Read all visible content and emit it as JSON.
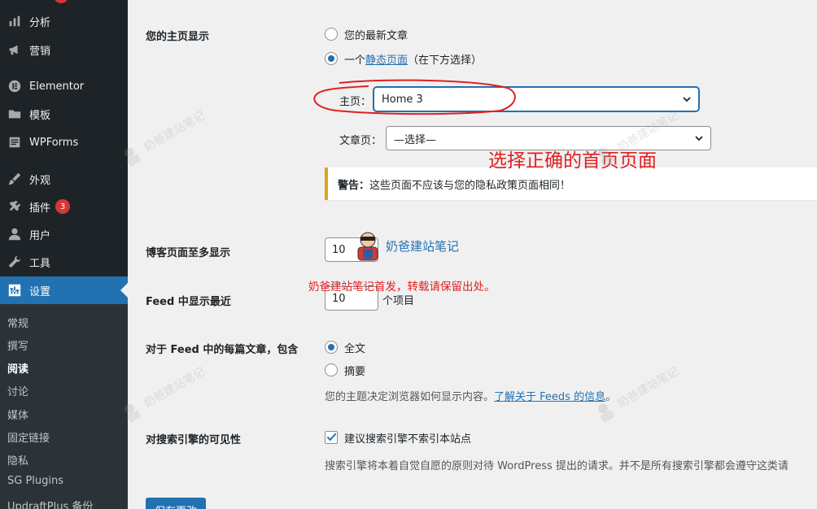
{
  "sidebar": {
    "menu": [
      {
        "label": "分析",
        "icon": "bar-chart-icon",
        "badge": ""
      },
      {
        "label": "营销",
        "icon": "megaphone-icon",
        "badge": ""
      },
      {
        "label": "Elementor",
        "icon": "elementor-icon",
        "badge": ""
      },
      {
        "label": "模板",
        "icon": "folder-icon",
        "badge": ""
      },
      {
        "label": "WPForms",
        "icon": "form-icon",
        "badge": ""
      },
      {
        "label": "外观",
        "icon": "brush-icon",
        "badge": ""
      },
      {
        "label": "插件",
        "icon": "plugin-icon",
        "badge": "3"
      },
      {
        "label": "用户",
        "icon": "user-icon",
        "badge": ""
      },
      {
        "label": "工具",
        "icon": "wrench-icon",
        "badge": ""
      },
      {
        "label": "设置",
        "icon": "settings-icon",
        "badge": ""
      }
    ],
    "submenu": [
      "常规",
      "撰写",
      "阅读",
      "讨论",
      "媒体",
      "固定链接",
      "隐私",
      "SG Plugins",
      "UpdraftPlus 备份"
    ],
    "current_submenu": "阅读"
  },
  "reading": {
    "homepage_display": {
      "label": "您的主页显示",
      "option_latest": "您的最新文章",
      "option_static_prefix": "一个",
      "option_static_link": "静态页面",
      "option_static_suffix": "（在下方选择）",
      "selected": "static"
    },
    "homepage_select": {
      "label": "主页：",
      "value": "Home 3"
    },
    "posts_select": {
      "label": "文章页：",
      "value": "—选择—"
    },
    "warning": {
      "title": "警告：",
      "text": "这些页面不应该与您的隐私政策页面相同！"
    },
    "blog_pages": {
      "label": "博客页面至多显示",
      "value": "10"
    },
    "feed_items": {
      "label": "Feed 中显示最近",
      "value": "10",
      "unit": "个项目"
    },
    "feed_content": {
      "label": "对于 Feed 中的每篇文章，包含",
      "option_full": "全文",
      "option_summary": "摘要",
      "selected": "full",
      "description": "您的主题决定浏览器如何显示内容。",
      "link": "了解关于 Feeds 的信息",
      "link_suffix": "。"
    },
    "search_visibility": {
      "label": "对搜索引擎的可见性",
      "checkbox": "建议搜索引擎不索引本站点",
      "checked": true,
      "description": "搜索引擎将本着自觉自愿的原则对待 WordPress 提出的请求。并不是所有搜索引擎都会遵守这类请"
    },
    "save_button": "保存更改"
  },
  "overlay": {
    "annotation": "选择正确的首页页面",
    "copyright": "奶爸建站笔记首发，转载请保留出处。",
    "stamp": "奶爸建站笔记",
    "watermark": "奶爸建站笔记"
  },
  "colors": {
    "sidebar_bg": "#1d2327",
    "submenu_bg": "#2c3338",
    "accent": "#2271b1",
    "warning_border": "#dba617",
    "annotation_red": "#e02020",
    "badge_red": "#d63638"
  }
}
